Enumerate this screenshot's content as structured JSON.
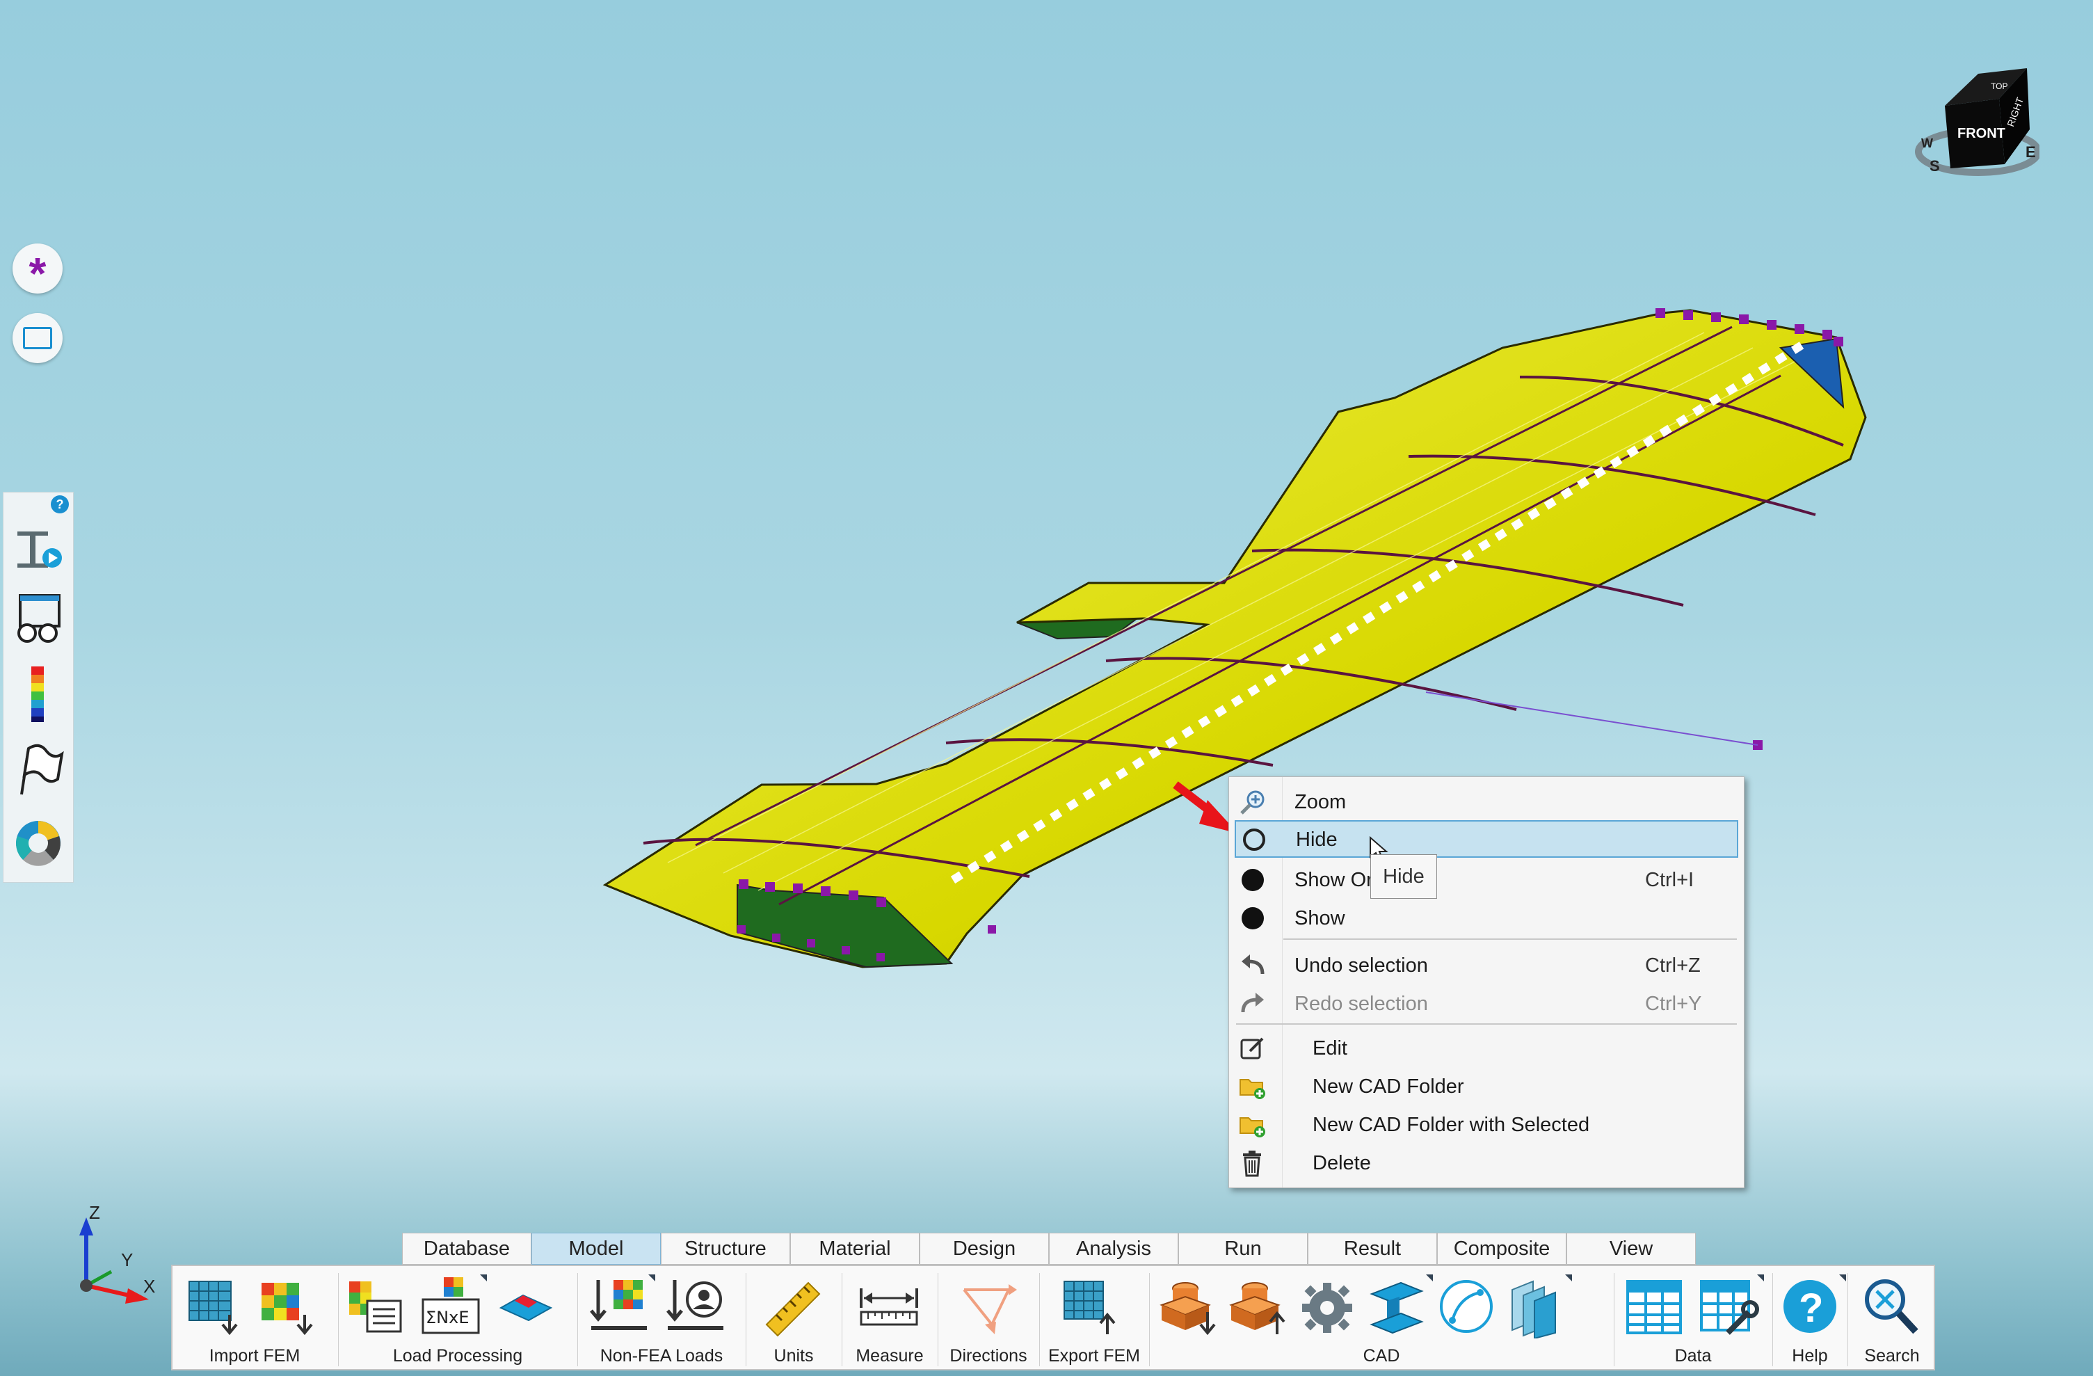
{
  "viewcube": {
    "faces": [
      "FRONT",
      "RIGHT",
      "TOP"
    ],
    "compass": [
      "W",
      "S",
      "E"
    ]
  },
  "axis_triad": {
    "labels": [
      "Z",
      "Y",
      "X"
    ]
  },
  "side_toolbar": {
    "help_badge": "?"
  },
  "context_menu": {
    "items": [
      {
        "icon": "zoom-icon",
        "label": "Zoom",
        "shortcut": ""
      },
      {
        "icon": "hide-circle-icon",
        "label": "Hide",
        "shortcut": "",
        "highlight": true
      },
      {
        "icon": "filled-circle-icon",
        "label": "Show Or",
        "shortcut": "Ctrl+I"
      },
      {
        "icon": "filled-circle-icon",
        "label": "Show",
        "shortcut": ""
      },
      {
        "icon": "undo-icon",
        "label": "Undo selection",
        "shortcut": "Ctrl+Z"
      },
      {
        "icon": "redo-icon",
        "label": "Redo selection",
        "shortcut": "Ctrl+Y",
        "disabled": true
      },
      {
        "icon": "edit-icon",
        "label": "Edit",
        "shortcut": ""
      },
      {
        "icon": "new-folder-icon",
        "label": "New CAD Folder",
        "shortcut": ""
      },
      {
        "icon": "new-folder-icon",
        "label": "New CAD Folder with Selected",
        "shortcut": ""
      },
      {
        "icon": "trash-icon",
        "label": "Delete",
        "shortcut": ""
      }
    ],
    "tooltip": "Hide"
  },
  "ribbon": {
    "tabs": [
      "Database",
      "Model",
      "Structure",
      "Material",
      "Design",
      "Analysis",
      "Run",
      "Result",
      "Composite",
      "View"
    ],
    "active_tab": "Model",
    "groups": [
      {
        "label": "Import FEM"
      },
      {
        "label": "Load Processing"
      },
      {
        "label": "Non-FEA Loads"
      },
      {
        "label": "Units"
      },
      {
        "label": "Measure"
      },
      {
        "label": "Directions"
      },
      {
        "label": "Export FEM"
      },
      {
        "label": "CAD"
      },
      {
        "label": "Data"
      },
      {
        "label": "Help"
      },
      {
        "label": "Search"
      }
    ],
    "sigma_text": "ΣNxE"
  },
  "colors": {
    "wing": "#dede00",
    "wing_inner": "#1f6b1f",
    "rib": "#5a1440",
    "marker": "#8a18a8",
    "accent": "#1a8fd0"
  }
}
